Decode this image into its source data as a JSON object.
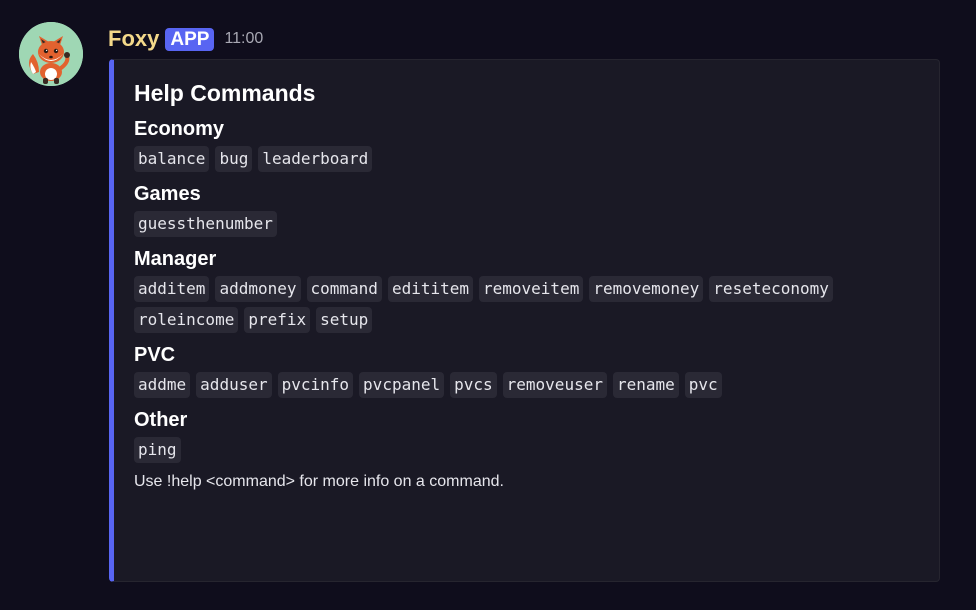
{
  "message": {
    "username": "Foxy",
    "badge": "APP",
    "timestamp": "11:00",
    "avatar_icon": "fox-avatar-icon"
  },
  "embed": {
    "accent_color": "#5865f2",
    "title": "Help Commands",
    "fields": [
      {
        "name": "Economy",
        "commands": [
          "balance",
          "bug",
          "leaderboard"
        ]
      },
      {
        "name": "Games",
        "commands": [
          "guessthenumber"
        ]
      },
      {
        "name": "Manager",
        "commands": [
          "additem",
          "addmoney",
          "command",
          "edititem",
          "removeitem",
          "removemoney",
          "reseteconomy",
          "roleincome",
          "prefix",
          "setup"
        ]
      },
      {
        "name": "PVC",
        "commands": [
          "addme",
          "adduser",
          "pvcinfo",
          "pvcpanel",
          "pvcs",
          "removeuser",
          "rename",
          "pvc"
        ]
      },
      {
        "name": "Other",
        "commands": [
          "ping"
        ]
      }
    ],
    "footer": "Use !help <command> for more info on a command."
  }
}
